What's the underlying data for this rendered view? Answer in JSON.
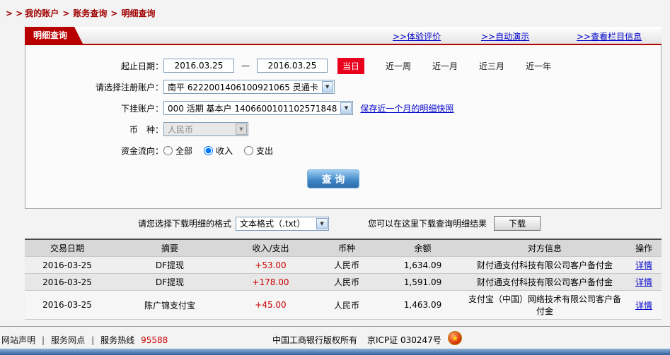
{
  "colors": {
    "accent_red": "#b80000",
    "link_blue": "#0000cc",
    "amount_red": "#cc0000",
    "today_red": "#e8001c"
  },
  "breadcrumb": {
    "prefix": "> >",
    "separator": ">",
    "items": [
      "我的账户",
      "账务查询",
      "明细查询"
    ]
  },
  "panel": {
    "tab_title": "明细查询",
    "links": [
      ">>体验评价",
      ">>自动演示",
      ">>查看栏目信息"
    ]
  },
  "form": {
    "date_label": "起止日期：",
    "date_from": "2016.03.25",
    "date_to": "2016.03.25",
    "dash": "—",
    "today_button": "当日",
    "quick_links": [
      "近一周",
      "近一月",
      "近三月",
      "近一年"
    ],
    "account_label": "请选择注册账户：",
    "account_value": "南平 6222001406100921065 灵通卡",
    "sub_account_label": "下挂账户：",
    "sub_account_value": "000 活期 基本户 1406600101102571848",
    "snapshot_link": "保存近一个月的明细快照",
    "currency_label": "币　种：",
    "currency_value": "人民币",
    "flow_label": "资金流向：",
    "flow_options": [
      "全部",
      "收入",
      "支出"
    ],
    "flow_selected": "收入",
    "query_button": "查 询"
  },
  "download": {
    "format_label": "请您选择下载明细的格式",
    "format_value": "文本格式（.txt）",
    "result_label": "您可以在这里下载查询明细结果",
    "button": "下载"
  },
  "table": {
    "headers": [
      "交易日期",
      "摘要",
      "收入/支出",
      "币种",
      "余额",
      "对方信息",
      "操作"
    ],
    "rows": [
      {
        "date": "2016-03-25",
        "summary": "DF提现",
        "amount": "+53.00",
        "currency": "人民币",
        "balance": "1,634.09",
        "counterparty": "财付通支付科技有限公司客户备付金",
        "action": "详情"
      },
      {
        "date": "2016-03-25",
        "summary": "DF提现",
        "amount": "+178.00",
        "currency": "人民币",
        "balance": "1,591.09",
        "counterparty": "财付通支付科技有限公司客户备付金",
        "action": "详情"
      },
      {
        "date": "2016-03-25",
        "summary": "陈广锦支付宝",
        "amount": "+45.00",
        "currency": "人民币",
        "balance": "1,463.09",
        "counterparty": "支付宝（中国）网络技术有限公司客户备付金",
        "action": "详情"
      }
    ]
  },
  "footer": {
    "links": [
      "网站声明",
      "服务网点"
    ],
    "separator": "|",
    "hotline_label": "服务热线",
    "hotline_number": "95588",
    "copyright": "中国工商银行版权所有",
    "icp": "京ICP证 030247号",
    "badge_icon": "emblem"
  }
}
